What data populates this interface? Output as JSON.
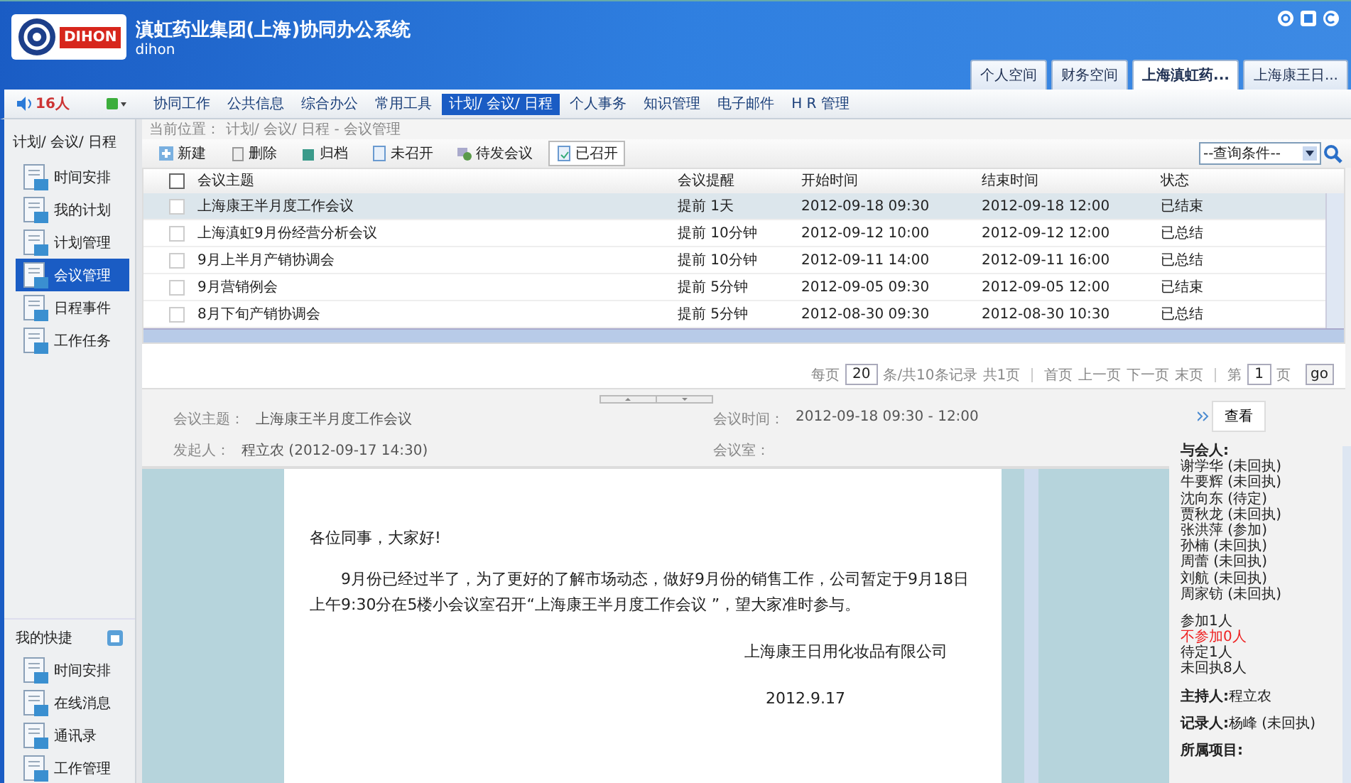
{
  "header": {
    "logo": "DIHON",
    "title": "滇虹药业集团(上海)协同办公系统",
    "subtitle": "dihon",
    "tabs": [
      {
        "label": "个人空间",
        "selected": false
      },
      {
        "label": "财务空间",
        "selected": false
      },
      {
        "label": "上海滇虹药...",
        "selected": true
      },
      {
        "label": "上海康王日...",
        "selected": false
      }
    ]
  },
  "nav": {
    "online": "16人",
    "menu": [
      {
        "label": "协同工作",
        "selected": false
      },
      {
        "label": "公共信息",
        "selected": false
      },
      {
        "label": "综合办公",
        "selected": false
      },
      {
        "label": "常用工具",
        "selected": false
      },
      {
        "label": "计划/ 会议/ 日程",
        "selected": true
      },
      {
        "label": "个人事务",
        "selected": false
      },
      {
        "label": "知识管理",
        "selected": false
      },
      {
        "label": "电子邮件",
        "selected": false
      },
      {
        "label": "H R 管理",
        "selected": false
      }
    ]
  },
  "sidebar": {
    "title": "计划/ 会议/ 日程",
    "items": [
      {
        "label": "时间安排",
        "selected": false
      },
      {
        "label": "我的计划",
        "selected": false
      },
      {
        "label": "计划管理",
        "selected": false
      },
      {
        "label": "会议管理",
        "selected": true
      },
      {
        "label": "日程事件",
        "selected": false
      },
      {
        "label": "工作任务",
        "selected": false
      }
    ],
    "shortcuts_title": "我的快捷",
    "shortcuts": [
      "时间安排",
      "在线消息",
      "通讯录",
      "工作管理"
    ]
  },
  "breadcrumb": {
    "label": "当前位置：",
    "path": "计划/ 会议/ 日程 - 会议管理"
  },
  "toolbar": [
    {
      "label": "新建",
      "selected": false
    },
    {
      "label": "删除",
      "selected": false
    },
    {
      "label": "归档",
      "selected": false
    },
    {
      "label": "未召开",
      "selected": false
    },
    {
      "label": "待发会议",
      "selected": false
    },
    {
      "label": "已召开",
      "selected": true
    }
  ],
  "search": {
    "value": "--查询条件--"
  },
  "table": {
    "columns": [
      "会议主题",
      "会议提醒",
      "开始时间",
      "结束时间",
      "状态"
    ],
    "header_checked": false,
    "rows": [
      {
        "cells": [
          "上海康王半月度工作会议",
          "提前 1天",
          "2012-09-18 09:30",
          "2012-09-18 12:00",
          "已结束"
        ],
        "selected": true,
        "checked": false
      },
      {
        "cells": [
          "上海滇虹9月份经营分析会议",
          "提前 10分钟",
          "2012-09-12 10:00",
          "2012-09-12 12:00",
          "已总结"
        ],
        "selected": false,
        "checked": false
      },
      {
        "cells": [
          "9月上半月产销协调会",
          "提前 10分钟",
          "2012-09-11 14:00",
          "2012-09-11 16:00",
          "已总结"
        ],
        "selected": false,
        "checked": false
      },
      {
        "cells": [
          "9月营销例会",
          "提前 5分钟",
          "2012-09-05 09:30",
          "2012-09-05 12:00",
          "已结束"
        ],
        "selected": false,
        "checked": false
      },
      {
        "cells": [
          "8月下旬产销协调会",
          "提前 5分钟",
          "2012-08-30 09:30",
          "2012-08-30 10:30",
          "已总结"
        ],
        "selected": false,
        "checked": false
      }
    ]
  },
  "pager": {
    "per_page_label": "每页",
    "per_page": "20",
    "summary": "条/共10条记录",
    "pages": "共1页",
    "links": [
      "首页",
      "上一页",
      "下一页",
      "末页"
    ],
    "page_label": "第",
    "page": "1",
    "page_suffix": "页",
    "go": "go"
  },
  "detail": {
    "fields": [
      {
        "label": "会议主题：",
        "value": "上海康王半月度工作会议"
      },
      {
        "label": "会议时间：",
        "value": "2012-09-18 09:30  -  12:00"
      },
      {
        "label": "发起人：",
        "value": "程立农 (2012-09-17 14:30)"
      },
      {
        "label": "会议室："
      }
    ],
    "greeting": "各位同事，大家好!",
    "body": "9月份已经过半了，为了更好的了解市场动态，做好9月份的销售工作，公司暂定于9月18日上午9:30分在5楼小会议室召开“上海康王半月度工作会议 ”，望大家准时参与。",
    "signature": "上海康王日用化妆品有限公司",
    "date": "2012.9.17"
  },
  "info": {
    "view_button": "查看",
    "attendees_title": "与会人:",
    "attendees": [
      "谢学华 (未回执)",
      "牛要辉 (未回执)",
      "沈向东 (待定)",
      "贾秋龙 (未回执)",
      "张洪萍 (参加)",
      "孙楠 (未回执)",
      "周蕾 (未回执)",
      "刘航 (未回执)",
      "周家钫 (未回执)"
    ],
    "summary": [
      {
        "text": "参加1人",
        "color": "#222222"
      },
      {
        "text": "不参加0人",
        "color": "#ee2222"
      },
      {
        "text": "待定1人",
        "color": "#222222"
      },
      {
        "text": "未回执8人",
        "color": "#222222"
      }
    ],
    "host": {
      "label": "主持人:",
      "value": "程立农"
    },
    "recorder": {
      "label": "记录人:",
      "value": "杨峰 (未回执)"
    },
    "project": {
      "label": "所属项目:"
    }
  }
}
